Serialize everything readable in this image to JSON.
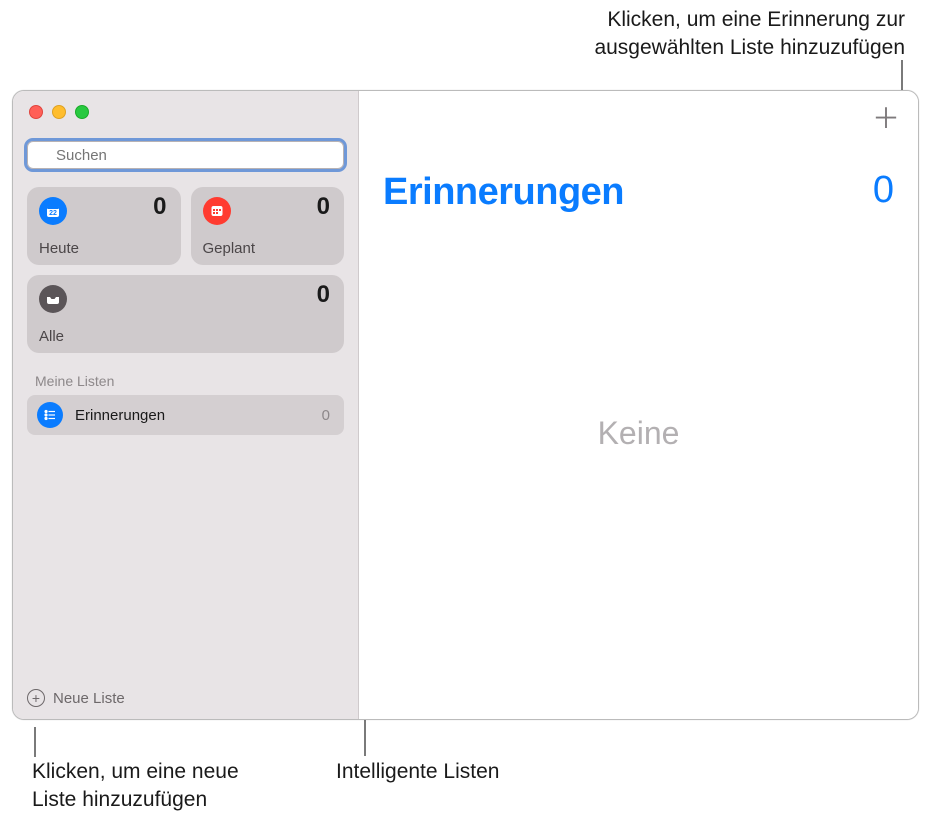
{
  "callouts": {
    "add_reminder_l1": "Klicken, um eine Erinnerung zur",
    "add_reminder_l2": "ausgewählten Liste hinzuzufügen",
    "new_list_l1": "Klicken, um eine neue",
    "new_list_l2": "Liste hinzuzufügen",
    "smart_lists": "Intelligente Listen"
  },
  "search": {
    "placeholder": "Suchen"
  },
  "smart": {
    "today": {
      "label": "Heute",
      "count": "0"
    },
    "scheduled": {
      "label": "Geplant",
      "count": "0"
    },
    "all": {
      "label": "Alle",
      "count": "0"
    }
  },
  "sidebar": {
    "section_header": "Meine Listen",
    "list0": {
      "name": "Erinnerungen",
      "count": "0"
    },
    "new_list_label": "Neue Liste"
  },
  "main": {
    "title": "Erinnerungen",
    "count": "0",
    "empty": "Keine"
  }
}
